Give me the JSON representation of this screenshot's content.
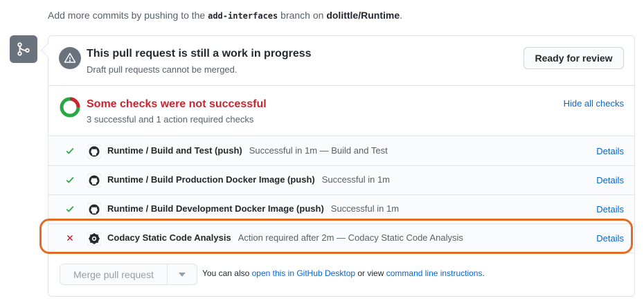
{
  "push_note": {
    "prefix": "Add more commits by pushing to the ",
    "branch": "add-interfaces",
    "middle": " branch on ",
    "repo": "dolittle/Runtime",
    "suffix": "."
  },
  "icons": {
    "merge": "git-merge-icon",
    "alert": "alert-icon",
    "github": "github-mark-icon",
    "codacy": "codacy-logo-icon",
    "check": "check-icon",
    "x": "x-icon",
    "caret": "caret-down-icon"
  },
  "wip": {
    "title": "This pull request is still a work in progress",
    "subtitle": "Draft pull requests cannot be merged.",
    "ready_button": "Ready for review"
  },
  "checks": {
    "title": "Some checks were not successful",
    "subtitle": "3 successful and 1 action required checks",
    "hide_link": "Hide all checks",
    "success_count": 3,
    "action_required_count": 1,
    "items": [
      {
        "name": "Runtime / Build and Test (push)",
        "desc": "Successful in 1m — Build and Test",
        "details": "Details",
        "status": "success"
      },
      {
        "name": "Runtime / Build Production Docker Image (push)",
        "desc": "Successful in 1m",
        "details": "Details",
        "status": "success"
      },
      {
        "name": "Runtime / Build Development Docker Image (push)",
        "desc": "Successful in 1m",
        "details": "Details",
        "status": "success"
      },
      {
        "name": "Codacy Static Code Analysis",
        "desc": "Action required after 2m — Codacy Static Code Analysis",
        "details": "Details",
        "status": "failure"
      }
    ]
  },
  "merge": {
    "button": "Merge pull request",
    "text_prefix": "You can also ",
    "desktop_link": "open this in GitHub Desktop",
    "text_middle": " or view ",
    "cli_link": "command line instructions",
    "text_suffix": "."
  },
  "colors": {
    "success": "#28a745",
    "failure": "#cb2431",
    "link": "#0366d6",
    "highlight": "#e36c25"
  }
}
